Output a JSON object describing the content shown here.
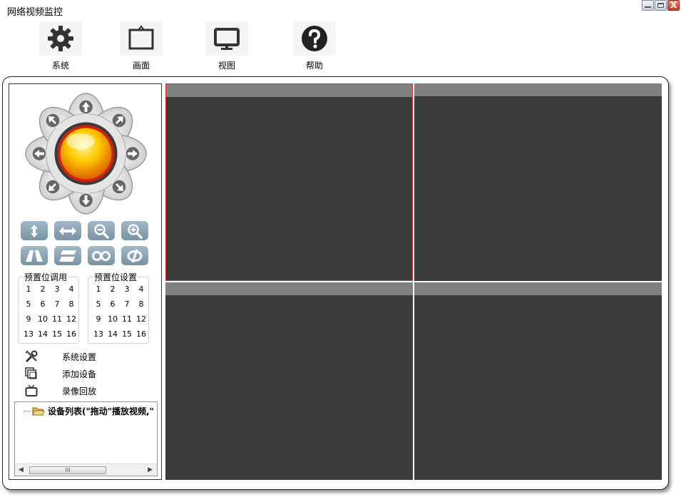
{
  "window": {
    "title": "网络视频监控",
    "close_glyph": "X"
  },
  "toolbar": [
    {
      "label": "系统",
      "icon": "gear-icon"
    },
    {
      "label": "画面",
      "icon": "screen-frame-icon"
    },
    {
      "label": "视图",
      "icon": "monitor-icon"
    },
    {
      "label": "帮助",
      "icon": "help-icon"
    }
  ],
  "ptz": {
    "directions": [
      "up",
      "up-right",
      "right",
      "down-right",
      "down",
      "down-left",
      "left",
      "up-left"
    ],
    "center_color": "#f7b500"
  },
  "lens_controls": [
    "vertical-scan",
    "horizontal-scan",
    "zoom-out",
    "zoom-in",
    "focus-near",
    "focus-far",
    "iris-loop",
    "iris-auto"
  ],
  "preset_call": {
    "title": "预置位调用",
    "numbers": [
      "1",
      "2",
      "3",
      "4",
      "5",
      "6",
      "7",
      "8",
      "9",
      "10",
      "11",
      "12",
      "13",
      "14",
      "15",
      "16"
    ]
  },
  "preset_set": {
    "title": "预置位设置",
    "numbers": [
      "1",
      "2",
      "3",
      "4",
      "5",
      "6",
      "7",
      "8",
      "9",
      "10",
      "11",
      "12",
      "13",
      "14",
      "15",
      "16"
    ]
  },
  "menu": [
    {
      "label": "系统设置",
      "icon": "tools-icon"
    },
    {
      "label": "添加设备",
      "icon": "add-device-icon"
    },
    {
      "label": "录像回放",
      "icon": "tv-icon"
    }
  ],
  "device_tree": {
    "root_label": "设备列表(\"拖动\"播放视频,\"",
    "scroll_thumb": "III"
  },
  "colors": {
    "video_bg": "#3c3c3c",
    "video_header": "#808080",
    "selected_border": "#e03030",
    "button_blue": "#8aa3b4"
  }
}
